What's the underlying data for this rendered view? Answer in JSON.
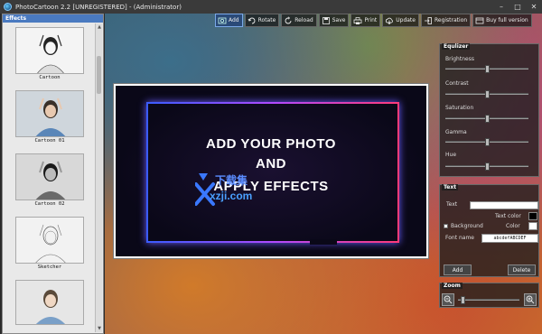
{
  "window": {
    "title": "PhotoCartoon 2.2 [UNREGISTERED] - (Administrator)",
    "controls": {
      "minimize": "–",
      "maximize": "□",
      "close": "✕"
    }
  },
  "effects": {
    "header": "Effects",
    "items": [
      {
        "label": "Cartoon"
      },
      {
        "label": "Cartoon 01"
      },
      {
        "label": "Cartoon 02"
      },
      {
        "label": "Sketcher"
      },
      {
        "label": ""
      }
    ]
  },
  "toolbar": {
    "add": "Add",
    "rotate": "Rotate",
    "reload": "Reload",
    "save": "Save",
    "print": "Print",
    "update": "Update",
    "registration": "Registration",
    "buy": "Buy full version"
  },
  "canvas": {
    "line1": "ADD YOUR PHOTO",
    "line2": "AND",
    "line3": "APPLY EFFECTS",
    "watermark_text": "下载集",
    "watermark_url": "xzji.com"
  },
  "equalizer": {
    "title": "Equlizer",
    "sliders": [
      {
        "label": "Brightness",
        "value": 0.5
      },
      {
        "label": "Contrast",
        "value": 0.5
      },
      {
        "label": "Saturation",
        "value": 0.5
      },
      {
        "label": "Gamma",
        "value": 0.5
      },
      {
        "label": "Hue",
        "value": 0.5
      }
    ]
  },
  "text_panel": {
    "title": "Text",
    "text_label": "Text",
    "text_value": "",
    "text_color_label": "Text color",
    "background_label": "Background",
    "color_label": "Color",
    "font_name_label": "Font name",
    "font_sample": "abcdefABCDEF",
    "add_button": "Add",
    "delete_button": "Delete",
    "text_color": "#000000",
    "bg_color": "#ffffff"
  },
  "zoom": {
    "title": "Zoom",
    "value": 0.05
  }
}
